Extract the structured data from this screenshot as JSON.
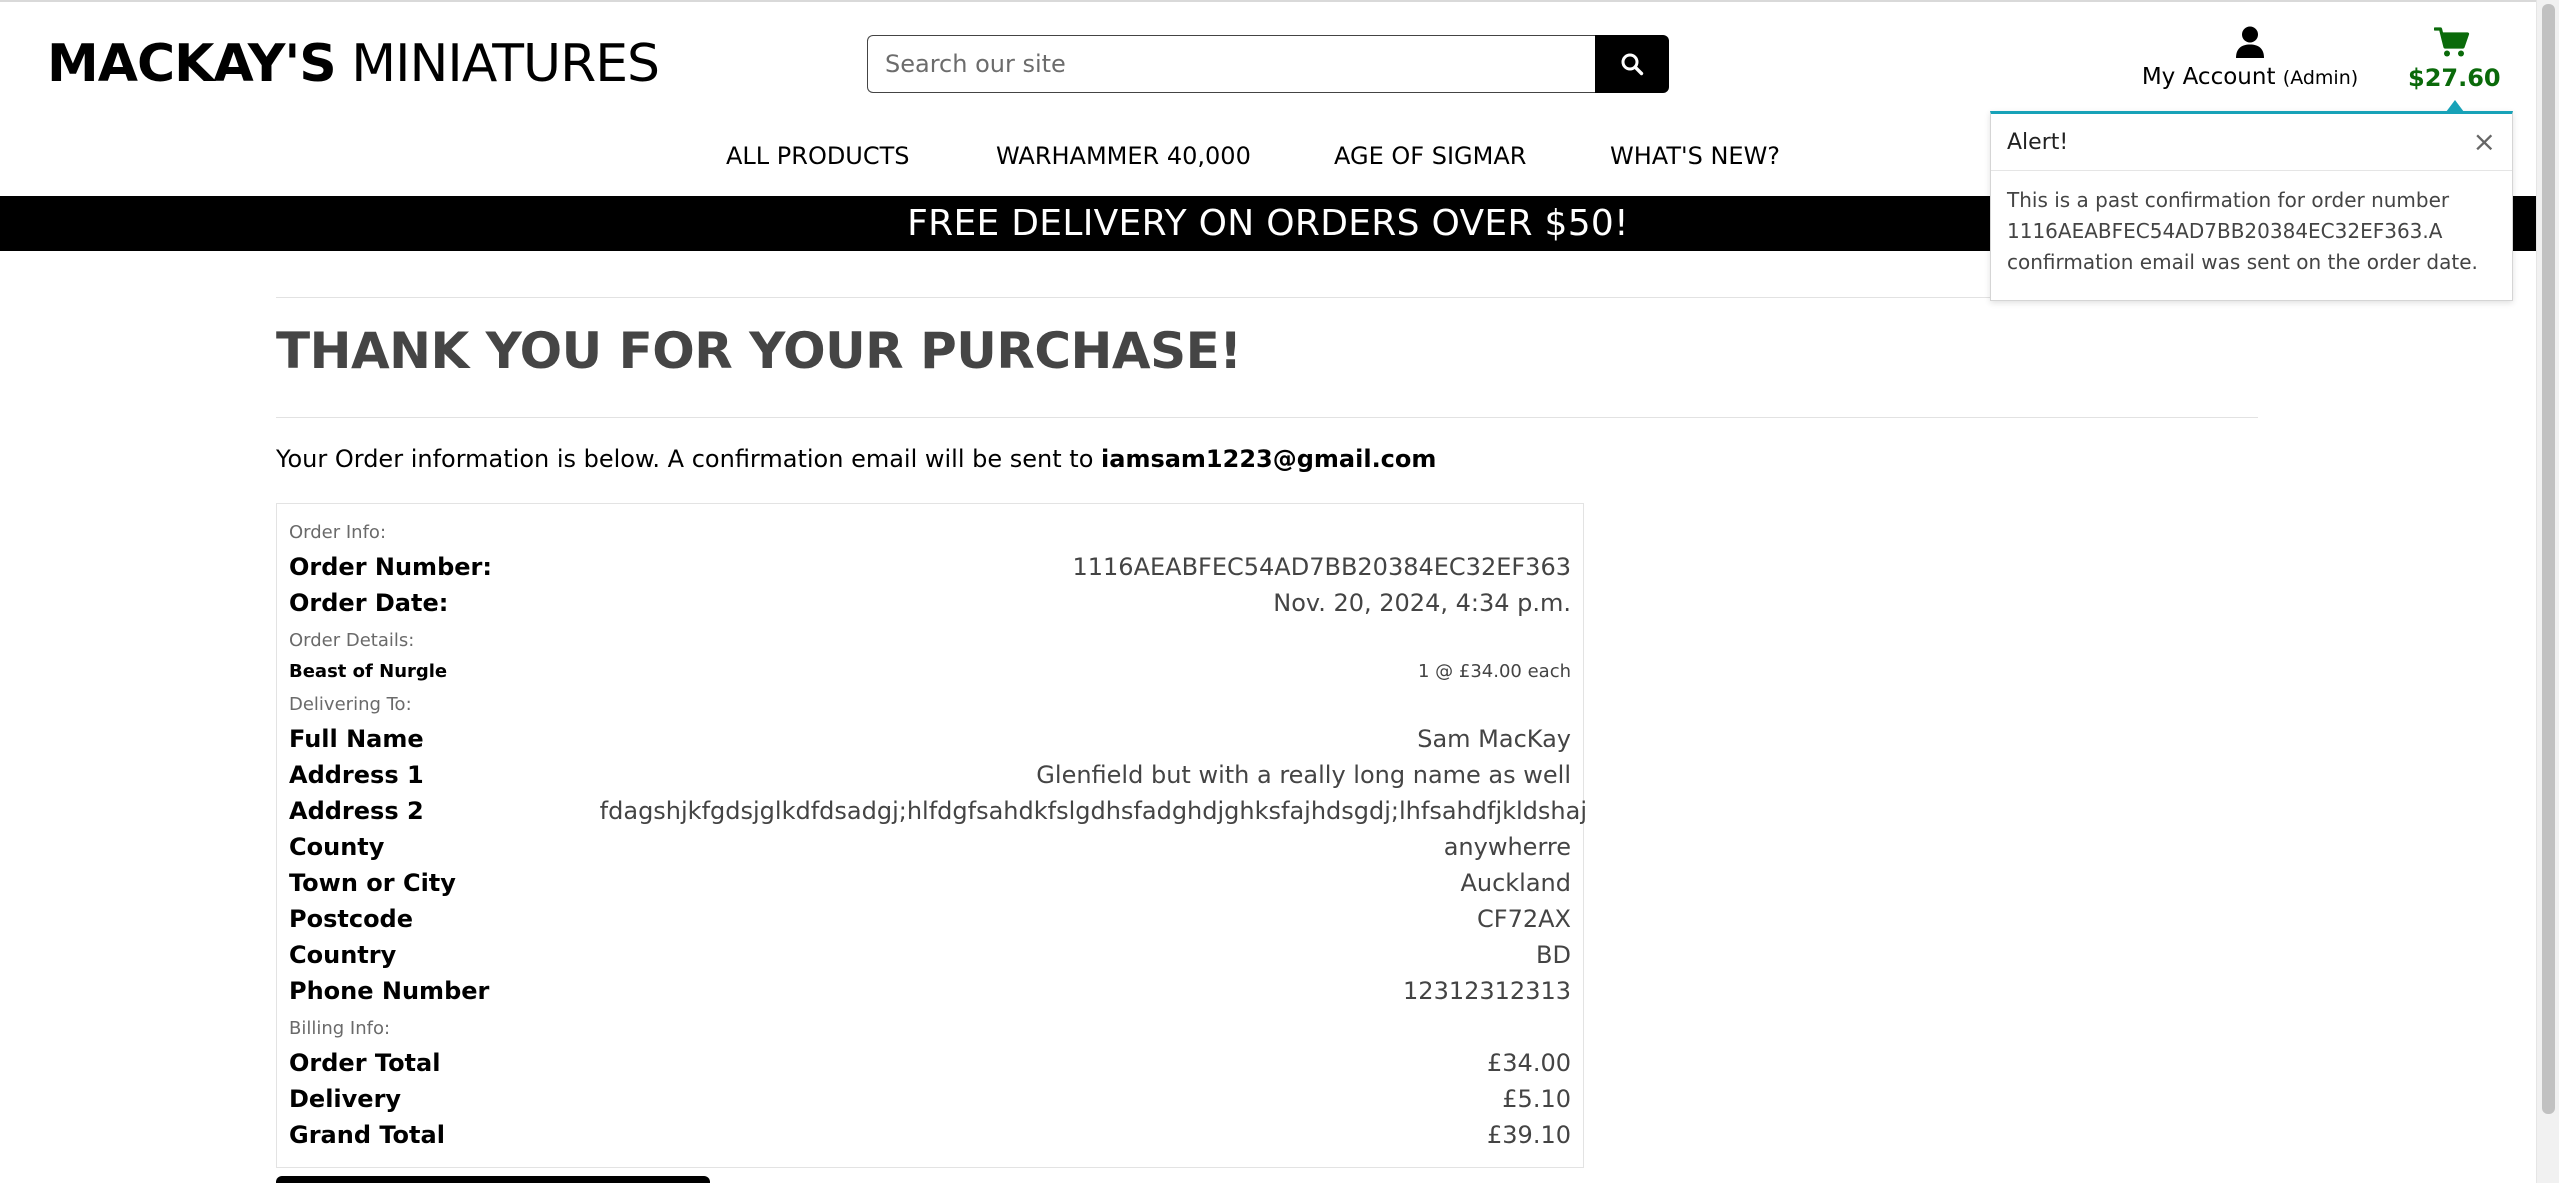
{
  "header": {
    "logo_bold": "MACKAY'S",
    "logo_rest": " MINIATURES",
    "search_placeholder": "Search our site",
    "account_label": "My Account",
    "account_role": "(Admin)",
    "cart_total": "$27.60",
    "cart_color": "#0a6a0a"
  },
  "nav": {
    "items": [
      "ALL PRODUCTS",
      "WARHAMMER 40,000",
      "AGE OF SIGMAR",
      "WHAT'S NEW?"
    ]
  },
  "banner": {
    "text": "FREE DELIVERY ON ORDERS OVER $50!"
  },
  "main": {
    "title": "THANK YOU FOR YOUR PURCHASE!",
    "intro_text": "Your Order information is below. A confirmation email will be sent to ",
    "intro_email": "iamsam1223@gmail.com"
  },
  "order": {
    "order_info_heading": "Order Info:",
    "order_number_label": "Order Number:",
    "order_number": "1116AEABFEC54AD7BB20384EC32EF363",
    "order_date_label": "Order Date:",
    "order_date": "Nov. 20, 2024, 4:34 p.m.",
    "order_details_heading": "Order Details:",
    "item_name": "Beast of Nurgle",
    "item_qty": "1 @ £34.00 each",
    "delivering_heading": "Delivering To:",
    "full_name_label": "Full Name",
    "full_name": "Sam MacKay",
    "address1_label": "Address 1",
    "address1": "Glenfield but with a really long name as well",
    "address2_label": "Address 2",
    "address2": "fdagshjkfgdsjglkdfdsadgj;hlfdgfsahdkfslgdhsfadghdjghksfajhdsgdj;lhfsahdfjkldshaj",
    "county_label": "County",
    "county": "anywherre",
    "town_label": "Town or City",
    "town": "Auckland",
    "postcode_label": "Postcode",
    "postcode": "CF72AX",
    "country_label": "Country",
    "country": "BD",
    "phone_label": "Phone Number",
    "phone": "12312312313",
    "billing_heading": "Billing Info:",
    "order_total_label": "Order Total",
    "order_total": "£34.00",
    "delivery_label": "Delivery",
    "delivery": "£5.10",
    "grand_total_label": "Grand Total",
    "grand_total": "£39.10"
  },
  "alert": {
    "title": "Alert!",
    "close": "×",
    "message": "This is a past confirmation for order number 1116AEABFEC54AD7BB20384EC32EF363.A confirmation email was sent on the order date.",
    "accent_color": "#17a2b8"
  }
}
